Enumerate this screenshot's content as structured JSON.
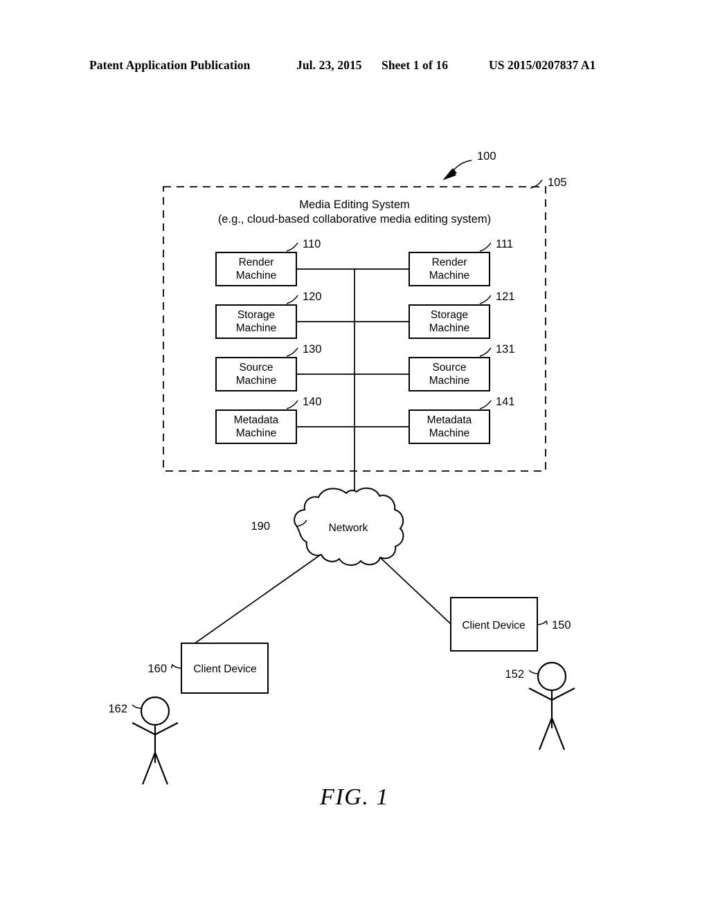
{
  "header": {
    "publication": "Patent Application Publication",
    "date": "Jul. 23, 2015",
    "sheet": "Sheet 1 of 16",
    "patent_number": "US 2015/0207837 A1"
  },
  "figure": {
    "caption": "FIG. 1",
    "overall_ref": "100"
  },
  "system": {
    "ref": "105",
    "title_line1": "Media Editing System",
    "title_line2": "(e.g., cloud-based collaborative media editing system)",
    "machines": [
      {
        "ref": "110",
        "line1": "Render",
        "line2": "Machine",
        "column": "left"
      },
      {
        "ref": "111",
        "line1": "Render",
        "line2": "Machine",
        "column": "right"
      },
      {
        "ref": "120",
        "line1": "Storage",
        "line2": "Machine",
        "column": "left"
      },
      {
        "ref": "121",
        "line1": "Storage",
        "line2": "Machine",
        "column": "right"
      },
      {
        "ref": "130",
        "line1": "Source",
        "line2": "Machine",
        "column": "left"
      },
      {
        "ref": "131",
        "line1": "Source",
        "line2": "Machine",
        "column": "right"
      },
      {
        "ref": "140",
        "line1": "Metadata",
        "line2": "Machine",
        "column": "left"
      },
      {
        "ref": "141",
        "line1": "Metadata",
        "line2": "Machine",
        "column": "right"
      }
    ]
  },
  "network": {
    "ref": "190",
    "label": "Network"
  },
  "clients": [
    {
      "ref": "150",
      "label": "Client Device",
      "position": "right"
    },
    {
      "ref": "160",
      "label": "Client Device",
      "position": "left"
    }
  ],
  "users": [
    {
      "ref": "152",
      "position": "right"
    },
    {
      "ref": "162",
      "position": "left"
    }
  ],
  "colors": {
    "ink": "#000000",
    "paper": "#ffffff"
  }
}
